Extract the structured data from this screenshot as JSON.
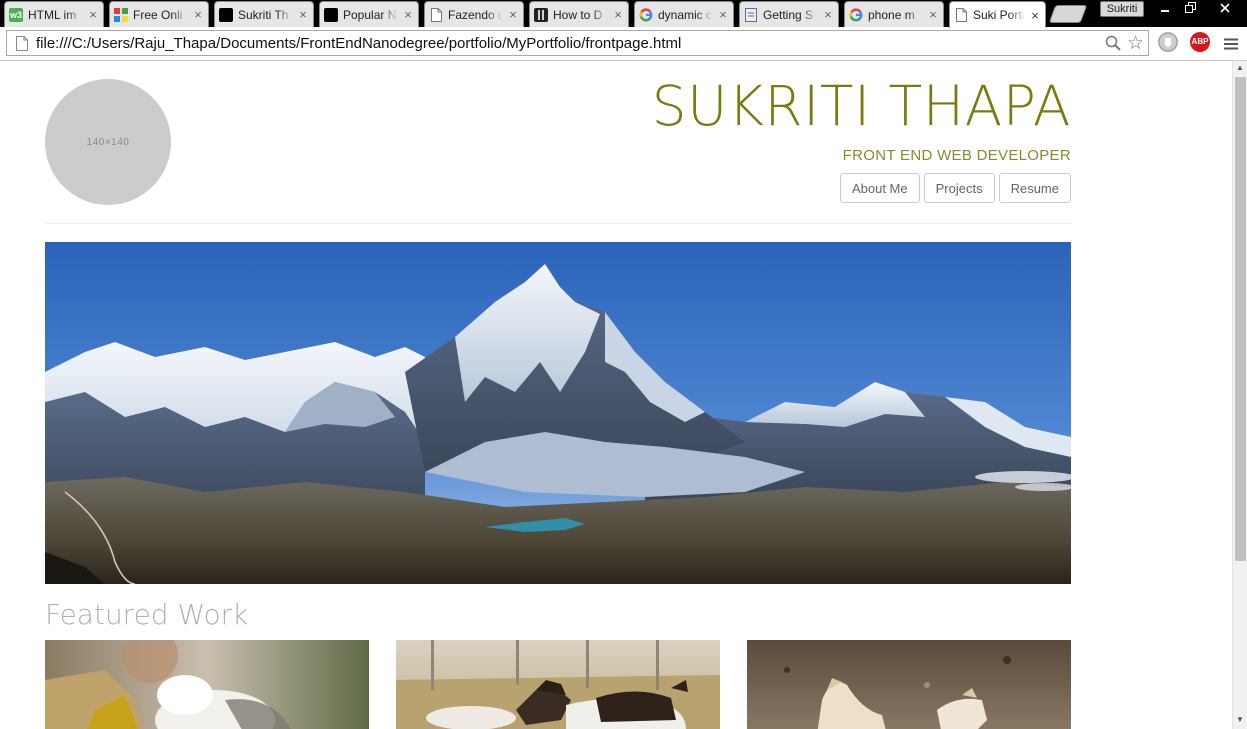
{
  "browser": {
    "tabs": [
      {
        "label": "HTML im",
        "favicon": "w3-icon",
        "color": "#4caf50"
      },
      {
        "label": "Free Onli",
        "favicon": "grid-icon",
        "color": "#e53935"
      },
      {
        "label": "Sukriti Th",
        "favicon": "black-square-icon",
        "color": "#000000"
      },
      {
        "label": "Popular N",
        "favicon": "black-square-icon",
        "color": "#000000"
      },
      {
        "label": "Fazendo u",
        "favicon": "document-icon",
        "color": "#ffffff"
      },
      {
        "label": "How to D",
        "favicon": "hashnode-icon",
        "color": "#222222"
      },
      {
        "label": "dynamic c",
        "favicon": "google-icon",
        "color": "#ffffff"
      },
      {
        "label": "Getting S",
        "favicon": "gist-icon",
        "color": "#ffffff"
      },
      {
        "label": "phone m",
        "favicon": "google-icon",
        "color": "#ffffff"
      },
      {
        "label": "Suki Porti",
        "favicon": "document-icon",
        "color": "#ffffff",
        "active": true
      }
    ],
    "tab_close": "×",
    "profile_name": "Sukriti",
    "url": "file:///C:/Users/Raju_Thapa/Documents/FrontEndNanodegree/portfolio/MyPortfolio/frontpage.html",
    "extensions": {
      "abp_label": "ABP"
    }
  },
  "page": {
    "avatar_placeholder": "140×140",
    "name": "SUKRITI THAPA",
    "role": "FRONT END WEB DEVELOPER",
    "nav": [
      "About Me",
      "Projects",
      "Resume"
    ],
    "featured_title": "Featured Work"
  },
  "colors": {
    "accent": "#7a7a0e",
    "role": "#8a8a2a",
    "featured": "#b5b0a8"
  }
}
